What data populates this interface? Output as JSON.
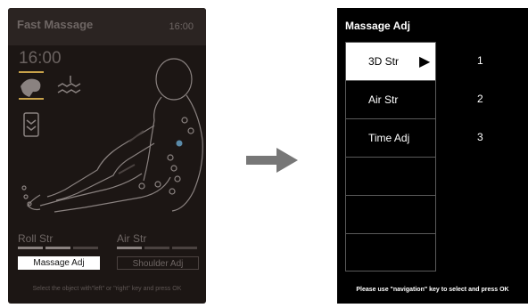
{
  "left_screen": {
    "title": "Fast Massage",
    "time": "16:00",
    "clock": "16:00",
    "roll_label": "Roll Str",
    "air_label": "Air Str",
    "roll_level": 2,
    "air_level": 1,
    "level_max": 3,
    "active_button": "Massage Adj",
    "inactive_button": "Shoulder Adj",
    "footer": "Select the object with\"left\" or \"right\" key and press OK",
    "icons": [
      "massage-hand-icon",
      "heat-wave-icon",
      "foot-roller-icon",
      "human-body-diagram"
    ]
  },
  "arrow": {
    "icon": "right-arrow-icon",
    "color": "#777777"
  },
  "right_screen": {
    "title": "Massage Adj",
    "menu": [
      {
        "label": "3D Str",
        "value": "1",
        "selected": true
      },
      {
        "label": "Air Str",
        "value": "2",
        "selected": false
      },
      {
        "label": "Time Adj",
        "value": "3",
        "selected": false
      },
      {
        "label": "",
        "value": "",
        "selected": false
      },
      {
        "label": "",
        "value": "",
        "selected": false
      },
      {
        "label": "",
        "value": "",
        "selected": false
      }
    ],
    "selector_icon": "play-triangle-icon",
    "footer": "Please use \"navigation\" key to select and press OK"
  },
  "colors": {
    "left_background": "#1c1614",
    "left_text": "#6e6664",
    "icon_accent": "#c8a24a",
    "body_point": "#5a8aa8",
    "right_background": "#000000"
  }
}
